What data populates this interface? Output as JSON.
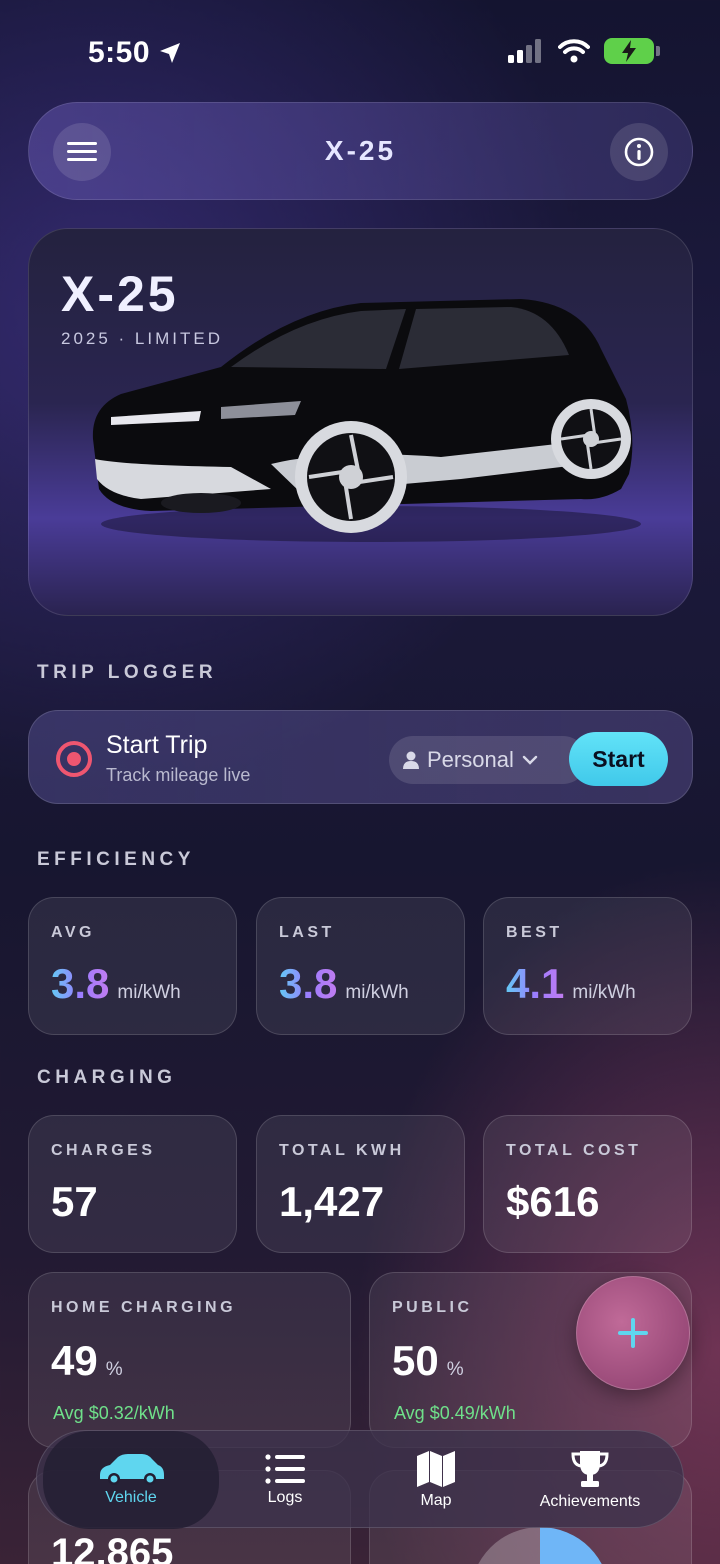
{
  "status": {
    "time": "5:50"
  },
  "header": {
    "title": "X-25"
  },
  "hero": {
    "model": "X-25",
    "subtitle": "2025 · LIMITED"
  },
  "trip": {
    "section": "TRIP LOGGER",
    "title": "Start Trip",
    "subtitle": "Track mileage live",
    "mode": "Personal",
    "start_label": "Start"
  },
  "efficiency": {
    "section": "EFFICIENCY",
    "cards": [
      {
        "label": "AVG",
        "value": "3.8",
        "unit": "mi/kWh"
      },
      {
        "label": "LAST",
        "value": "3.8",
        "unit": "mi/kWh"
      },
      {
        "label": "BEST",
        "value": "4.1",
        "unit": "mi/kWh"
      }
    ]
  },
  "charging": {
    "section": "CHARGING",
    "cards": [
      {
        "label": "CHARGES",
        "value": "57"
      },
      {
        "label": "TOTAL KWH",
        "value": "1,427"
      },
      {
        "label": "TOTAL COST",
        "value": "$616"
      }
    ],
    "home": {
      "label": "HOME CHARGING",
      "value": "49",
      "unit": "%",
      "avg": "Avg $0.32/kWh"
    },
    "public": {
      "label": "PUBLIC",
      "value": "50",
      "unit": "%",
      "avg": "Avg $0.49/kWh"
    }
  },
  "peek": {
    "value": "12,865"
  },
  "tabs": [
    {
      "label": "Vehicle",
      "icon": "car-icon",
      "active": true
    },
    {
      "label": "Logs",
      "icon": "list-icon"
    },
    {
      "label": "Map",
      "icon": "map-icon"
    },
    {
      "label": "Achievements",
      "icon": "trophy-icon"
    }
  ],
  "colors": {
    "accent": "#5fd6ef",
    "record": "#ef5670",
    "positive": "#6fe08a"
  }
}
